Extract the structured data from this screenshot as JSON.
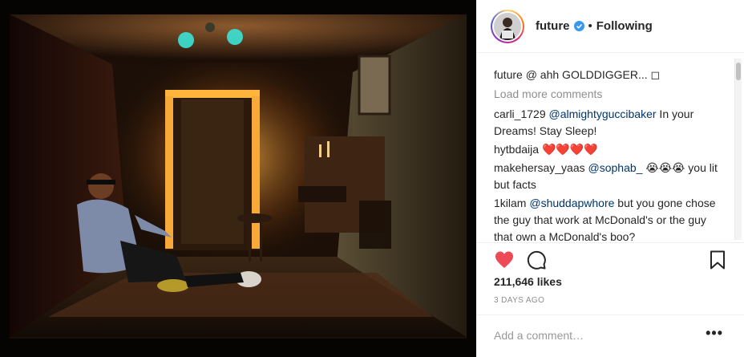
{
  "post": {
    "photo_icon": "photo-scene"
  },
  "header": {
    "username": "future",
    "separator": "•",
    "follow_status": "Following"
  },
  "caption": {
    "username": "future",
    "text": "@ ahh GOLDDIGGER... ◻"
  },
  "load_more": "Load more comments",
  "comments": [
    {
      "user": "carli_1729",
      "mention": "@almightyguccibaker",
      "text": " In your Dreams! Stay Sleep!"
    },
    {
      "user": "hytbdaija",
      "mention": "",
      "text": " ❤️❤️❤️❤️"
    },
    {
      "user": "makehersay_yaas",
      "mention": "@sophab_",
      "text": " 😭😭😭 you lit but facts"
    },
    {
      "user": "1kilam",
      "mention": "@shuddapwhore",
      "text": " but you gone chose the guy that work at McDonald's or the guy that own a McDonald's boo?"
    }
  ],
  "likes": "211,646 likes",
  "date": "3 DAYS AGO",
  "comment_box": {
    "placeholder": "Add a comment…",
    "more_label": "•••"
  },
  "colors": {
    "like": "#ed4956",
    "mention": "#003569",
    "verified": "#3897f0"
  }
}
